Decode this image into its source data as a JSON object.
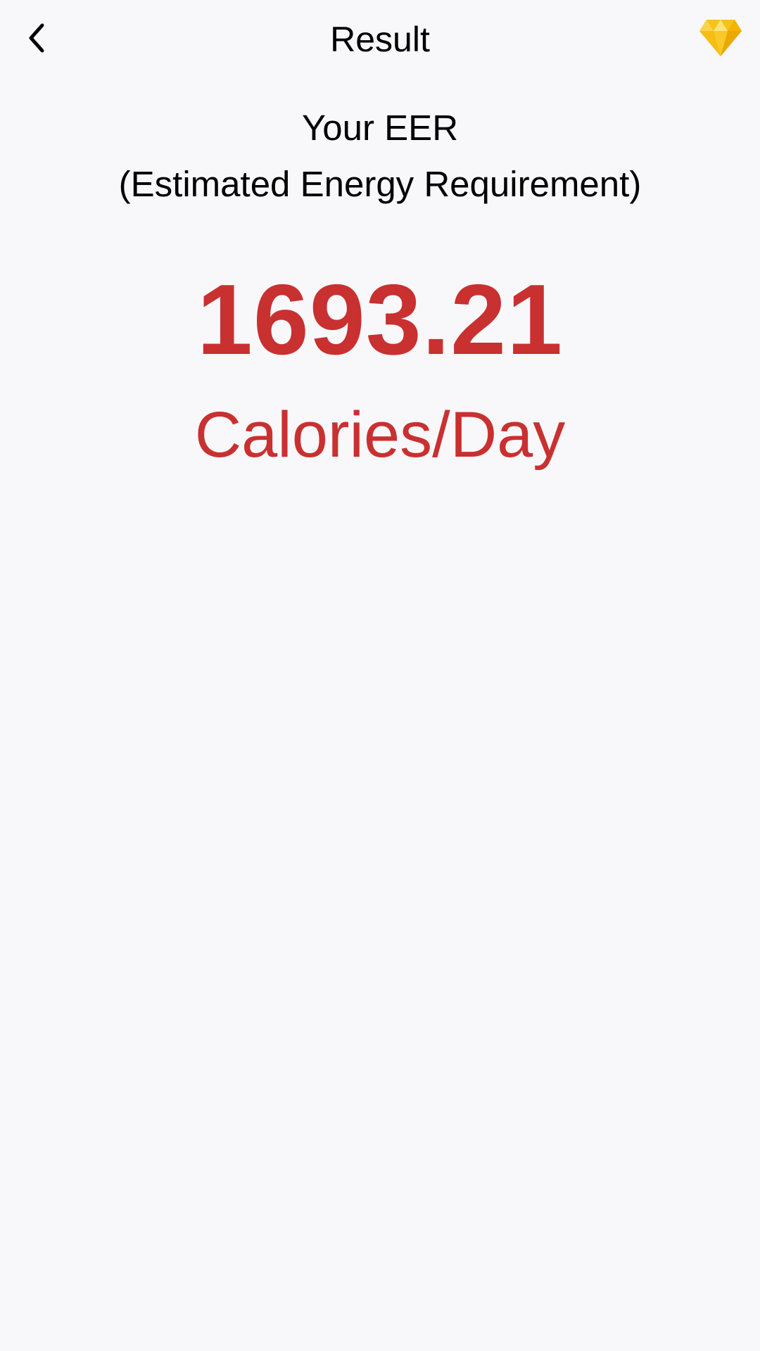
{
  "header": {
    "title": "Result",
    "back_icon": "chevron-left-icon",
    "premium_icon": "diamond-icon"
  },
  "result": {
    "heading_line1": "Your EER",
    "heading_line2": "(Estimated Energy Requirement)",
    "value": "1693.21",
    "unit": "Calories/Day"
  },
  "colors": {
    "background": "#f8f8fa",
    "accent": "#c93030",
    "diamond": "#f7c21a"
  }
}
